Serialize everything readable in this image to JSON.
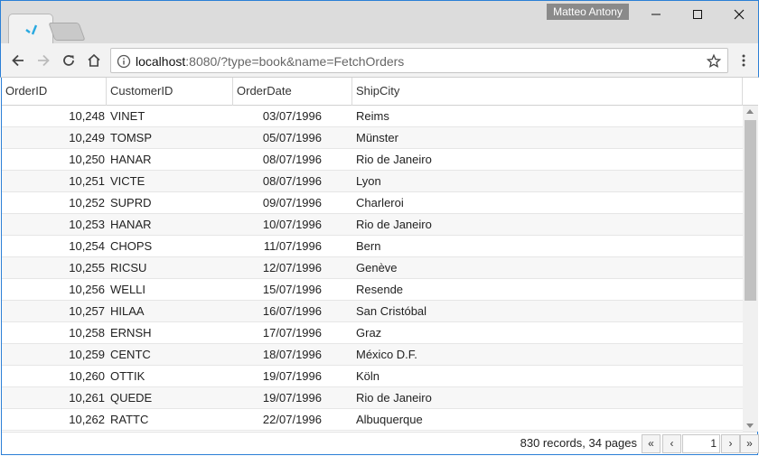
{
  "window": {
    "profile_name": "Matteo Antony"
  },
  "toolbar": {
    "url_host": "localhost",
    "url_rest": ":8080/?type=book&name=FetchOrders"
  },
  "grid": {
    "columns": [
      "OrderID",
      "CustomerID",
      "OrderDate",
      "ShipCity"
    ],
    "rows": [
      {
        "id": "10,248",
        "customer": "VINET",
        "date": "03/07/1996",
        "city": "Reims"
      },
      {
        "id": "10,249",
        "customer": "TOMSP",
        "date": "05/07/1996",
        "city": "Münster"
      },
      {
        "id": "10,250",
        "customer": "HANAR",
        "date": "08/07/1996",
        "city": "Rio de Janeiro"
      },
      {
        "id": "10,251",
        "customer": "VICTE",
        "date": "08/07/1996",
        "city": "Lyon"
      },
      {
        "id": "10,252",
        "customer": "SUPRD",
        "date": "09/07/1996",
        "city": "Charleroi"
      },
      {
        "id": "10,253",
        "customer": "HANAR",
        "date": "10/07/1996",
        "city": "Rio de Janeiro"
      },
      {
        "id": "10,254",
        "customer": "CHOPS",
        "date": "11/07/1996",
        "city": "Bern"
      },
      {
        "id": "10,255",
        "customer": "RICSU",
        "date": "12/07/1996",
        "city": "Genève"
      },
      {
        "id": "10,256",
        "customer": "WELLI",
        "date": "15/07/1996",
        "city": "Resende"
      },
      {
        "id": "10,257",
        "customer": "HILAA",
        "date": "16/07/1996",
        "city": "San Cristóbal"
      },
      {
        "id": "10,258",
        "customer": "ERNSH",
        "date": "17/07/1996",
        "city": "Graz"
      },
      {
        "id": "10,259",
        "customer": "CENTC",
        "date": "18/07/1996",
        "city": "México D.F."
      },
      {
        "id": "10,260",
        "customer": "OTTIK",
        "date": "19/07/1996",
        "city": "Köln"
      },
      {
        "id": "10,261",
        "customer": "QUEDE",
        "date": "19/07/1996",
        "city": "Rio de Janeiro"
      },
      {
        "id": "10,262",
        "customer": "RATTC",
        "date": "22/07/1996",
        "city": "Albuquerque"
      }
    ]
  },
  "pager": {
    "summary": "830 records, 34 pages",
    "first_label": "«",
    "prev_label": "‹",
    "current_page": "1",
    "next_label": "›",
    "last_label": "»"
  },
  "colors": {
    "window_border": "#2b7fd6",
    "favicon_accent": "#29a9e0"
  }
}
